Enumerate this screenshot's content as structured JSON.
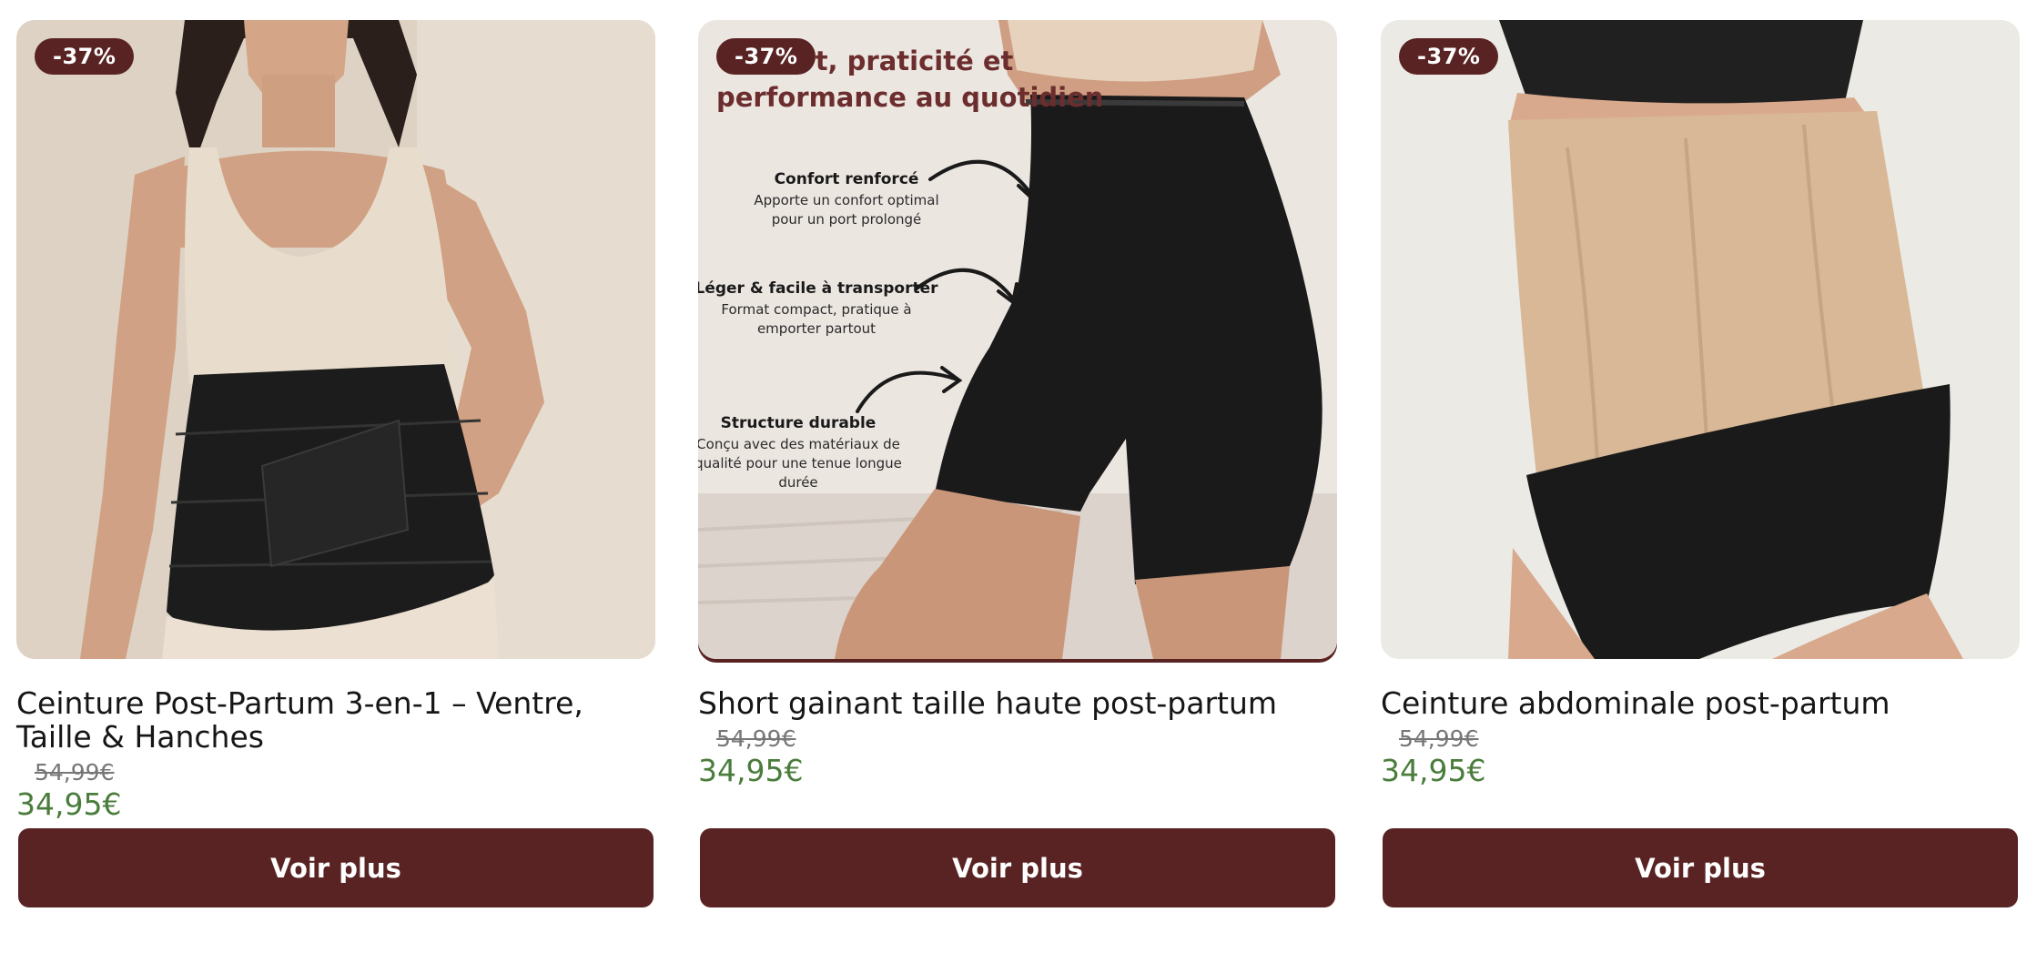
{
  "products": [
    {
      "badge": "-37%",
      "title": "Ceinture Post-Partum 3-en-1 – Ventre, Taille & Hanches",
      "old_price": "54,99€",
      "new_price": "34,95€",
      "button": "Voir plus"
    },
    {
      "badge": "-37%",
      "title": "Short gainant taille haute post-partum",
      "old_price": "54,99€",
      "new_price": "34,95€",
      "button": "Voir plus",
      "image_text": {
        "headline_1": "Confort, praticité et",
        "headline_2": "performance au quotidien",
        "features": [
          {
            "title": "Confort renforcé",
            "line1": "Apporte un confort optimal",
            "line2": "pour un port prolongé",
            "line3": ""
          },
          {
            "title": "Léger & facile à transporter",
            "line1": "Format compact, pratique à",
            "line2": "emporter partout",
            "line3": ""
          },
          {
            "title": "Structure durable",
            "line1": "Conçu avec des matériaux de",
            "line2": "qualité pour une tenue longue",
            "line3": "durée"
          }
        ]
      }
    },
    {
      "badge": "-37%",
      "title": "Ceinture abdominale post-partum",
      "old_price": "54,99€",
      "new_price": "34,95€",
      "button": "Voir plus"
    }
  ],
  "colors": {
    "accent": "#5a2323",
    "price_green": "#4a7d3c",
    "old_price_gray": "#777777"
  },
  "icons": [
    "arrow-icon"
  ]
}
